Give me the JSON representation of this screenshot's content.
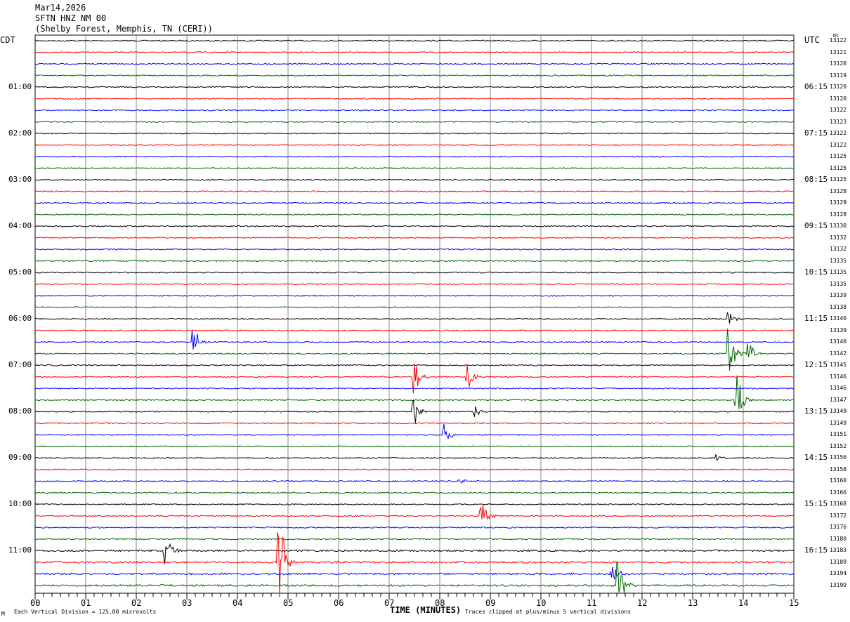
{
  "header": {
    "date": "Mar14,2026",
    "station": "SFTN HNZ NM 00",
    "location": "(Shelby Forest, Memphis, TN (CERI))"
  },
  "chart_data": {
    "type": "line",
    "title": "SFTN HNZ NM 00 helicorder",
    "xlabel": "TIME (MINUTES)",
    "xlim": [
      0,
      15
    ],
    "x_ticks": [
      "00",
      "01",
      "02",
      "03",
      "04",
      "05",
      "06",
      "07",
      "08",
      "09",
      "10",
      "11",
      "12",
      "13",
      "14",
      "15"
    ],
    "left_axis_title": "CDT",
    "right_axis_title": "UTC",
    "dc_title": "DC",
    "trace_colors": [
      "#000000",
      "#ff0000",
      "#0000ff",
      "#006400"
    ],
    "cdt_labels": [
      {
        "row": 4,
        "text": "01:00"
      },
      {
        "row": 8,
        "text": "02:00"
      },
      {
        "row": 12,
        "text": "03:00"
      },
      {
        "row": 16,
        "text": "04:00"
      },
      {
        "row": 20,
        "text": "05:00"
      },
      {
        "row": 24,
        "text": "06:00"
      },
      {
        "row": 28,
        "text": "07:00"
      },
      {
        "row": 32,
        "text": "08:00"
      },
      {
        "row": 36,
        "text": "09:00"
      },
      {
        "row": 40,
        "text": "10:00"
      },
      {
        "row": 44,
        "text": "11:00"
      }
    ],
    "utc_labels": [
      {
        "row": 4,
        "text": "06:15"
      },
      {
        "row": 8,
        "text": "07:15"
      },
      {
        "row": 12,
        "text": "08:15"
      },
      {
        "row": 16,
        "text": "09:15"
      },
      {
        "row": 20,
        "text": "10:15"
      },
      {
        "row": 24,
        "text": "11:15"
      },
      {
        "row": 28,
        "text": "12:15"
      },
      {
        "row": 32,
        "text": "13:15"
      },
      {
        "row": 36,
        "text": "14:15"
      },
      {
        "row": 40,
        "text": "15:15"
      },
      {
        "row": 44,
        "text": "16:15"
      }
    ],
    "dc_values": [
      "13122",
      "13121",
      "13120",
      "13119",
      "13120",
      "13120",
      "13122",
      "13123",
      "13122",
      "13122",
      "13125",
      "13125",
      "13125",
      "13128",
      "13129",
      "13128",
      "13130",
      "13132",
      "13132",
      "13135",
      "13135",
      "13135",
      "13139",
      "13138",
      "13140",
      "13139",
      "13140",
      "13142",
      "13145",
      "13146",
      "13146",
      "13147",
      "13149",
      "13149",
      "13151",
      "13152",
      "13156",
      "13158",
      "13160",
      "13166",
      "13168",
      "13172",
      "13176",
      "13180",
      "13183",
      "13189",
      "13194",
      "13199"
    ],
    "events": [
      {
        "row": 24,
        "minute": 13.7,
        "amplitude": 0.6
      },
      {
        "row": 26,
        "minute": 3.12,
        "amplitude": 1.2
      },
      {
        "row": 27,
        "minute": 13.7,
        "amplitude": 2.5
      },
      {
        "row": 27,
        "minute": 14.1,
        "amplitude": 1.0
      },
      {
        "row": 29,
        "minute": 7.47,
        "amplitude": 1.5
      },
      {
        "row": 29,
        "minute": 8.54,
        "amplitude": 1.1
      },
      {
        "row": 31,
        "minute": 13.85,
        "amplitude": 2.5
      },
      {
        "row": 32,
        "minute": 7.47,
        "amplitude": 1.3
      },
      {
        "row": 32,
        "minute": 8.68,
        "amplitude": 0.6
      },
      {
        "row": 34,
        "minute": 8.08,
        "amplitude": 1.0
      },
      {
        "row": 36,
        "minute": 13.47,
        "amplitude": 0.3
      },
      {
        "row": 38,
        "minute": 8.4,
        "amplitude": 0.2
      },
      {
        "row": 41,
        "minute": 8.82,
        "amplitude": 1.5
      },
      {
        "row": 44,
        "minute": 2.57,
        "amplitude": 1.4
      },
      {
        "row": 45,
        "minute": 4.82,
        "amplitude": 3.0
      },
      {
        "row": 46,
        "minute": 11.39,
        "amplitude": 1.2
      },
      {
        "row": 47,
        "minute": 11.53,
        "amplitude": 2.0
      }
    ]
  },
  "footer": {
    "scale": "Each Vertical Division =  125.00 microvolts",
    "clip": "Traces clipped at plus/minus 5 vertical divisions",
    "logo": "M"
  }
}
